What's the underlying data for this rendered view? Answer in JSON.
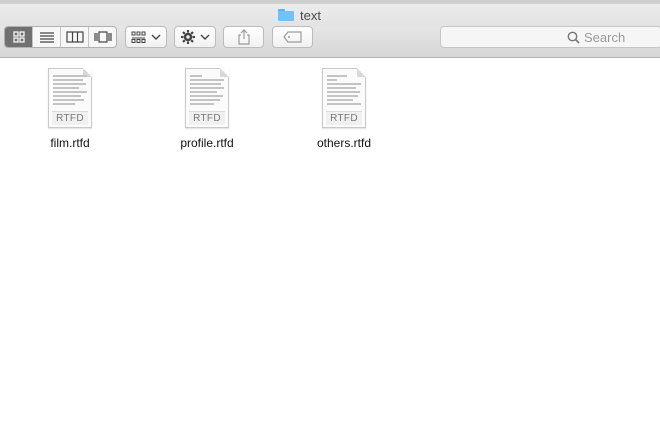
{
  "window": {
    "title": "text"
  },
  "toolbar": {
    "view_buttons": [
      "icon-view",
      "list-view",
      "column-view",
      "cover-flow-view"
    ],
    "arrange_icon": "arrange-grid-icon",
    "action_icon": "gear-icon",
    "share_icon": "share-icon",
    "tag_icon": "tag-icon"
  },
  "search": {
    "placeholder": "Search"
  },
  "files": [
    {
      "name": "film.rtfd",
      "badge": "RTFD"
    },
    {
      "name": "profile.rtfd",
      "badge": "RTFD"
    },
    {
      "name": "others.rtfd",
      "badge": "RTFD"
    }
  ],
  "colors": {
    "folder": "#74c2f5",
    "active_view": "#707070"
  }
}
